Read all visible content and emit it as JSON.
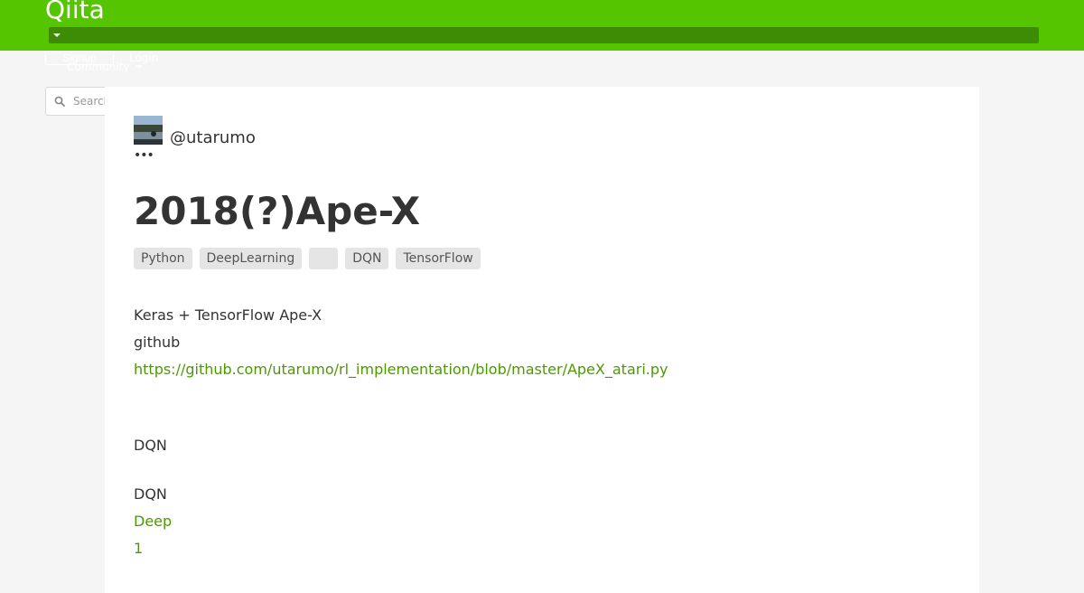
{
  "header": {
    "logo_text": "Qiita",
    "signup_label": "Signup",
    "login_label": "Login",
    "community_label": "Community",
    "search_placeholder": "Search"
  },
  "article": {
    "author": "@utarumo",
    "more_menu": "•••",
    "title": "2018(?)Ape-X",
    "tags": [
      "Python",
      "DeepLearning",
      "",
      "DQN",
      "TensorFlow"
    ],
    "lines": [
      "Keras + TensorFlow  Ape-X",
      "github",
      "https://github.com/utarumo/rl_implementation/blob/master/ApeX_atari.py",
      "DQN",
      "DQN",
      "Deep",
      "1"
    ]
  },
  "colors": {
    "brand_green": "#55c500",
    "header_dark_green": "#3e8c05",
    "link_green": "#4b9a00",
    "tag_bg": "#e5e5e5",
    "page_bg": "#f5f5f5"
  }
}
